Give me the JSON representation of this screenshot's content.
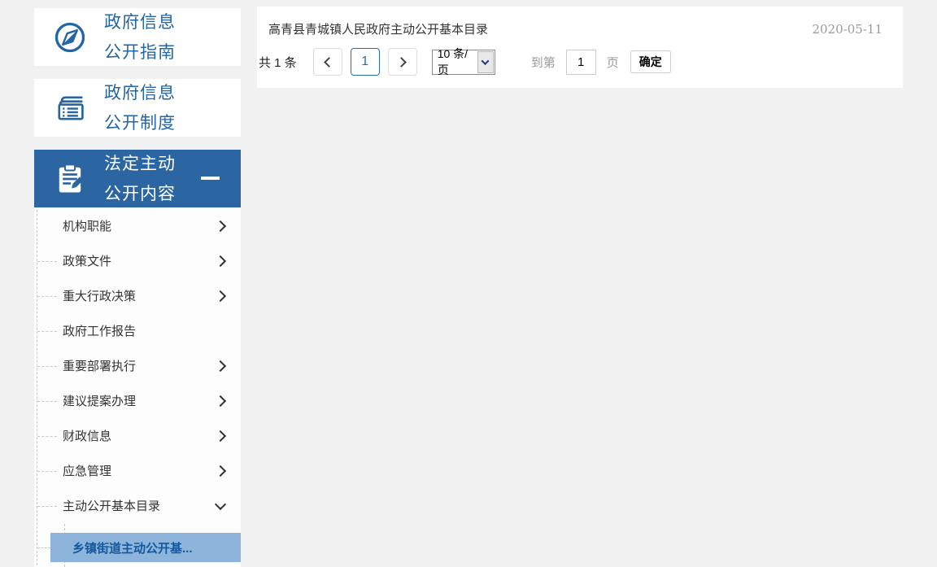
{
  "colors": {
    "accent": "#2a64a3",
    "active_card_bg": "#2b66a3",
    "highlight_bg": "#8db4db",
    "highlight_text": "#12589e",
    "page_bg": "#f1f1f1"
  },
  "sidebar": {
    "items": [
      {
        "line1": "政府信息",
        "line2": "公开指南",
        "icon": "compass-icon"
      },
      {
        "line1": "政府信息",
        "line2": "公开制度",
        "icon": "ledger-icon"
      },
      {
        "line1": "法定主动",
        "line2": "公开内容",
        "icon": "clipboard-pencil-icon",
        "state": "expanded",
        "collapse_icon": "minus-icon"
      }
    ],
    "sub_items": [
      {
        "label": "机构职能",
        "chevron": "right"
      },
      {
        "label": "政策文件",
        "chevron": "right"
      },
      {
        "label": "重大行政决策",
        "chevron": "right"
      },
      {
        "label": "政府工作报告",
        "chevron": "none"
      },
      {
        "label": "重要部署执行",
        "chevron": "right"
      },
      {
        "label": "建议提案办理",
        "chevron": "right"
      },
      {
        "label": "财政信息",
        "chevron": "right"
      },
      {
        "label": "应急管理",
        "chevron": "right"
      },
      {
        "label": "主动公开基本目录",
        "chevron": "down"
      }
    ],
    "active_sub_item": "乡镇街道主动公开基..."
  },
  "main": {
    "list": [
      {
        "title": "高青县青城镇人民政府主动公开基本目录",
        "date": "2020-05-11"
      }
    ],
    "pagination": {
      "total": "共 1 条",
      "current_page": "1",
      "page_size": "10 条/页",
      "goto_label": "到第",
      "goto_value": "1",
      "goto_unit": "页",
      "confirm_label": "确定"
    }
  }
}
